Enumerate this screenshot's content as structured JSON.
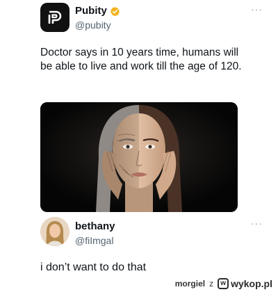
{
  "post": {
    "author_name": "Pubity",
    "handle": "@pubity",
    "verified_icon": "verified-badge-icon",
    "logo_icon": "pubity-logo-icon",
    "more_label": "···",
    "text": "Doctor says in 10 years time, humans will be able to live and work till the age of 120.",
    "accent_color": "#f3b21b"
  },
  "reply": {
    "author_name": "bethany",
    "handle": "@fiImgal",
    "more_label": "···",
    "text": "i don’t want to do that"
  },
  "footer": {
    "username": "morgiel",
    "separator": "z",
    "site": "wykop.pl",
    "site_icon": "wykop-logo-icon"
  }
}
